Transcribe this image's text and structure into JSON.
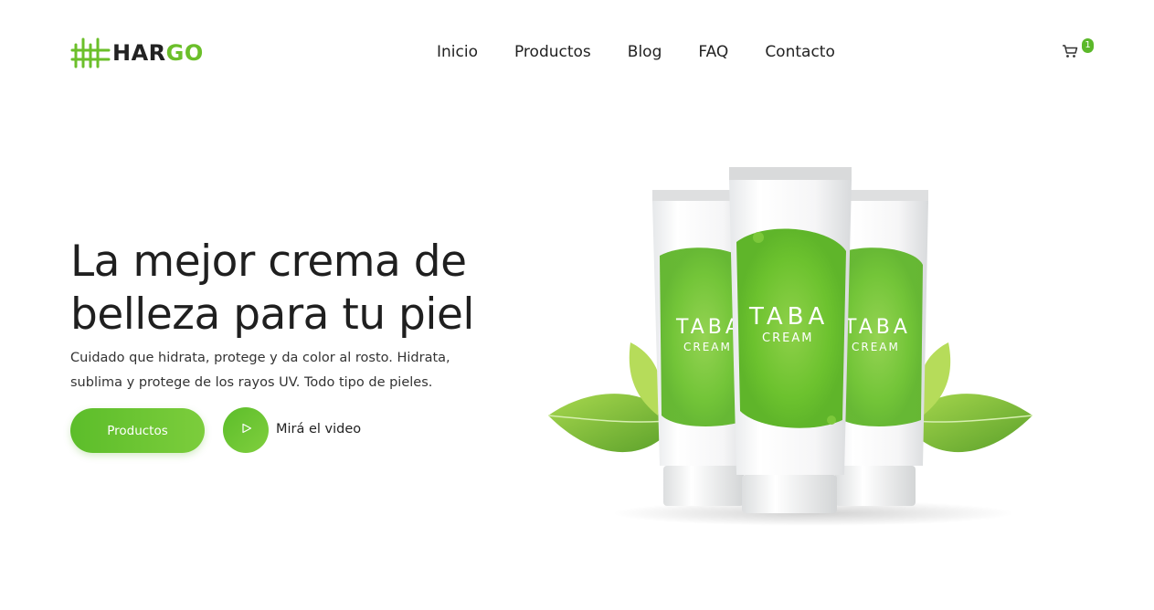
{
  "brand": {
    "part1": "HAR",
    "part2": "GO",
    "accent_color": "#6bbf2a"
  },
  "nav": {
    "items": [
      "Inicio",
      "Productos",
      "Blog",
      "FAQ",
      "Contacto"
    ]
  },
  "cart": {
    "icon": "cart-icon",
    "count": "1"
  },
  "hero": {
    "title": "La mejor crema de belleza para tu piel",
    "subtitle": "Cuidado que hidrata, protege y da color al rosto. Hidrata, sublima y protege de los rayos UV. Todo tipo de pieles.",
    "primary_button": "Productos",
    "video_label": "Mirá el video",
    "play_icon": "play-icon"
  },
  "product": {
    "name_line1": "TABA",
    "name_line2": "CREAM"
  }
}
